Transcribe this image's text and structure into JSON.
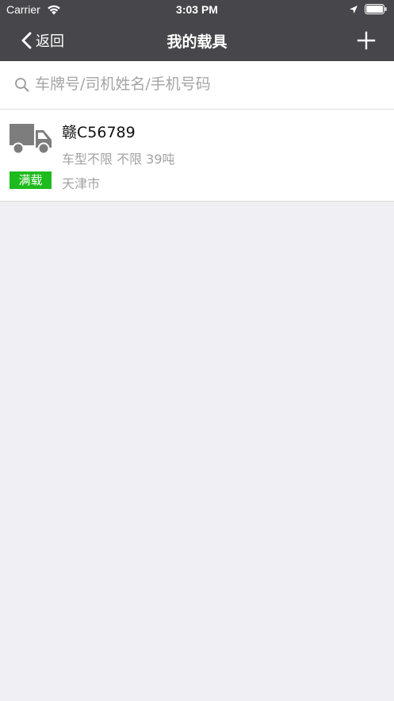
{
  "status_bar": {
    "carrier": "Carrier",
    "time": "3:03 PM"
  },
  "nav": {
    "back_label": "返回",
    "title": "我的载具",
    "add_icon": "plus-icon",
    "back_icon": "chevron-left-icon"
  },
  "search": {
    "placeholder": "车牌号/司机姓名/手机号码",
    "value": "",
    "icon": "search-icon"
  },
  "vehicles": [
    {
      "plate": "赣C56789",
      "specs": "车型不限 不限 39吨",
      "status": "满载",
      "city": "天津市",
      "icon": "truck-icon"
    }
  ],
  "colors": {
    "nav_bg": "#47474b",
    "page_bg": "#efeff4",
    "badge_bg": "#1dbb1d",
    "secondary_text": "#a3a3a3",
    "icon_gray": "#7d7d7d"
  }
}
